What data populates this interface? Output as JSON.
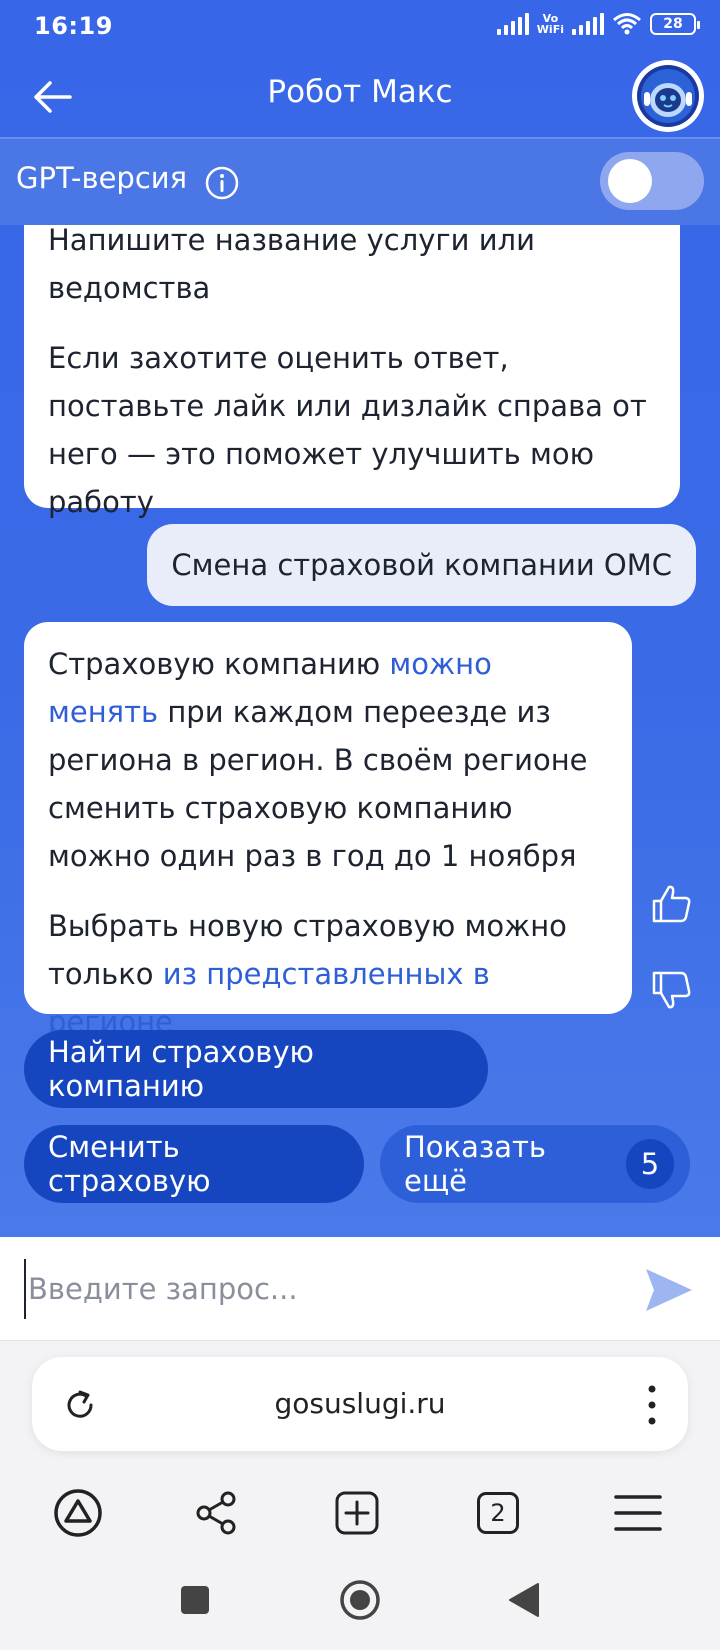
{
  "status_bar": {
    "time": "16:19",
    "battery": "28",
    "vowifi": "Vo\nWiFi"
  },
  "header": {
    "title": "Робот Макс"
  },
  "gpt": {
    "label": "GPT-версия",
    "enabled": false
  },
  "messages": {
    "bot1": {
      "p1": "Напишите название услуги или ведомства",
      "p2": "Если захотите оценить ответ, поставьте лайк или дизлайк справа от него — это поможет улучшить мою работу"
    },
    "user1": "Смена страховой компании ОМС",
    "bot2": {
      "p1_before": "Страховую компанию ",
      "p1_link": "можно менять",
      "p1_after": " при каждом переезде из региона в регион. В своём регионе сменить страховую компанию можно один раз в год до 1 ноября",
      "p2_before": "Выбрать новую страховую можно только ",
      "p2_link": "из представленных в регионе"
    }
  },
  "quick_replies": {
    "find": "Найти страховую компанию",
    "change": "Сменить страховую",
    "more": "Показать ещё",
    "more_count": "5"
  },
  "input": {
    "placeholder": "Введите запрос..."
  },
  "browser": {
    "url": "gosuslugi.ru",
    "tabs": "2"
  },
  "colors": {
    "primary_blue": "#3767e8",
    "button_blue": "#1645c0",
    "link": "#2f5fd6"
  }
}
